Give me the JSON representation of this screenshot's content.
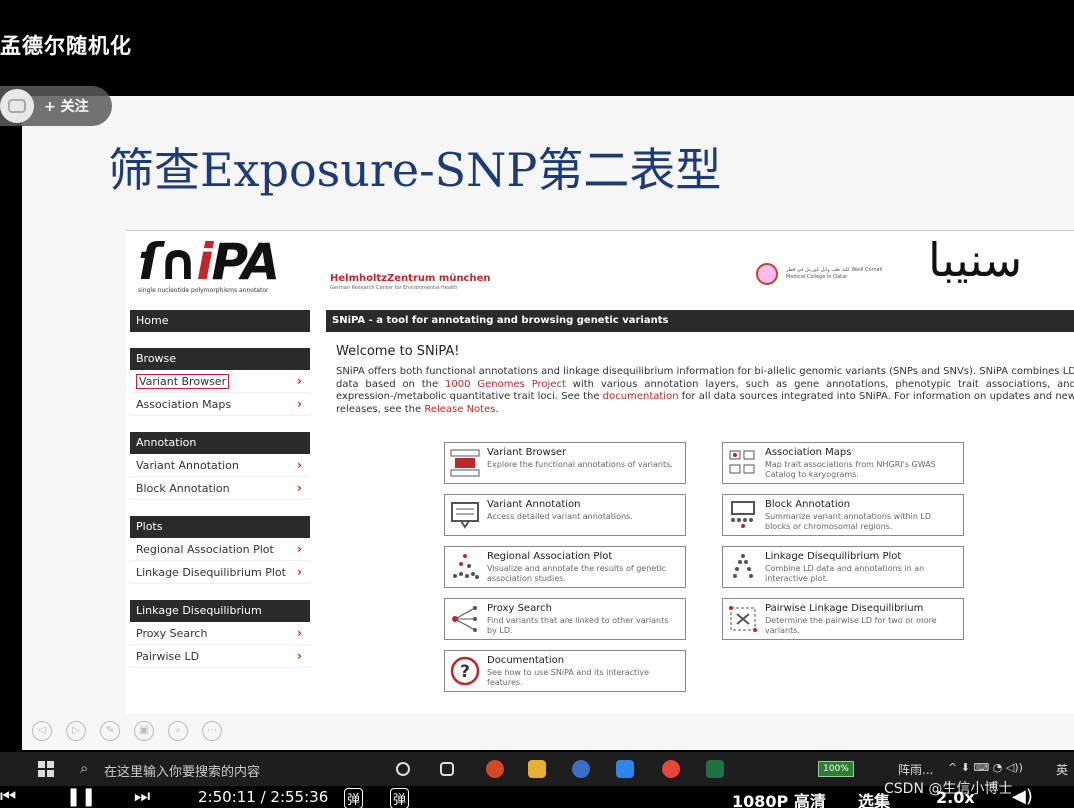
{
  "video": {
    "title": "孟德尔随机化"
  },
  "follow": {
    "label": "+ 关注"
  },
  "slide": {
    "heading": "筛查Exposure-SNP第二表型"
  },
  "snipa": {
    "logo": {
      "text_a": "ſ∩",
      "text_i": "i",
      "text_b": "PA",
      "sub": "single nucleotide polymorphisms annotator"
    },
    "helmholtz": {
      "name": "HelmholtzZentrum münchen",
      "sub": "German Research Center for Environmental Health"
    },
    "wcmc": {
      "text": "كلية طب وايل كورنيل في قطر Weill Cornell Medical College in Qatar"
    },
    "arabic_logo": "سنيبا",
    "sidebar": {
      "home": "Home",
      "sections": [
        {
          "title": "Browse",
          "items": [
            "Variant Browser",
            "Association Maps"
          ]
        },
        {
          "title": "Annotation",
          "items": [
            "Variant Annotation",
            "Block Annotation"
          ]
        },
        {
          "title": "Plots",
          "items": [
            "Regional Association Plot",
            "Linkage Disequilibrium Plot"
          ]
        },
        {
          "title": "Linkage Disequilibrium",
          "items": [
            "Proxy Search",
            "Pairwise LD"
          ]
        }
      ],
      "chevron": "›"
    },
    "main_bar": "SNiPA - a tool for annotating and browsing genetic variants",
    "welcome": "Welcome to SNiPA!",
    "intro": {
      "p1": "SNiPA offers both functional annotations and linkage disequilibrium information for bi-allelic genomic variants (SNPs and SNVs). SNiPA combines LD data based on the ",
      "link1": "1000 Genomes Project",
      "p2": " with various annotation layers, such as gene annotations, phenotypic trait associations, and expression-/metabolic quantitative trait loci. See the ",
      "link2": "documentation",
      "p3": " for all data sources integrated into SNiPA. For information on updates and new releases, see the ",
      "link3": "Release Notes",
      "p4": "."
    },
    "cards": [
      {
        "title": "Variant Browser",
        "desc": "Explore the functional annotations of variants."
      },
      {
        "title": "Association Maps",
        "desc": "Map trait associations from NHGRI's GWAS Catalog to karyograms."
      },
      {
        "title": "Variant Annotation",
        "desc": "Access detailed variant annotations."
      },
      {
        "title": "Block Annotation",
        "desc": "Summarize variant annotations within LD blocks or chromosomal regions."
      },
      {
        "title": "Regional Association Plot",
        "desc": "Visualize and annotate the results of genetic association studies."
      },
      {
        "title": "Linkage Disequilibrium Plot",
        "desc": "Combine LD data and annotations in an interactive plot."
      },
      {
        "title": "Proxy Search",
        "desc": "Find variants that are linked to other variants by LD."
      },
      {
        "title": "Pairwise Linkage Disequilibrium",
        "desc": "Determine the pairwise LD for two or more variants."
      },
      {
        "title": "Documentation",
        "desc": "See how to use SNiPA and its interactive features."
      }
    ]
  },
  "taskbar": {
    "search_placeholder": "在这里输入你要搜索的内容",
    "battery": "100%",
    "weather": "阵雨...",
    "tray": "^ ⬇ ⌨ ◔ ◁))",
    "lang": "英"
  },
  "player": {
    "time": "2:50:11 / 2:55:36",
    "danmaku1": "弹",
    "danmaku2": "弹",
    "quality": "1080P 高清",
    "select": "选集",
    "speed": "2.0x"
  },
  "watermark": "CSDN @生信小博士",
  "colors": {
    "accent": "#c0262b",
    "heading": "#1f3b73",
    "sidebar_head": "#2b2b2b"
  },
  "icons": [
    "windows-icon",
    "search-icon",
    "taskview-icon",
    "powerpoint-icon",
    "folder-icon",
    "r-icon",
    "chat-icon",
    "chrome-icon",
    "excel-icon",
    "battery-icon",
    "umbrella-icon"
  ]
}
